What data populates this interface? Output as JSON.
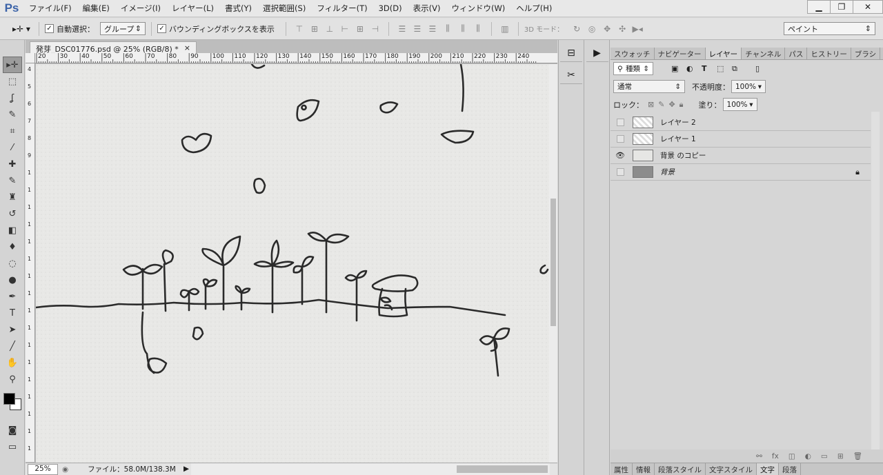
{
  "app": {
    "logo": "Ps"
  },
  "menu": [
    "ファイル(F)",
    "編集(E)",
    "イメージ(I)",
    "レイヤー(L)",
    "書式(Y)",
    "選択範囲(S)",
    "フィルター(T)",
    "3D(D)",
    "表示(V)",
    "ウィンドウ(W)",
    "ヘルプ(H)"
  ],
  "window_controls": {
    "minimize": "▁",
    "restore": "❐",
    "close": "✕"
  },
  "options": {
    "auto_select_label": "自動選択：",
    "auto_select_value": "グループ",
    "bounding_box_label": "バウンディングボックスを表示",
    "mode3d_label": "3D モード：",
    "workspace": "ペイント"
  },
  "document": {
    "tab_title": "発芽_DSC01776.psd @ 25% (RGB/8) *",
    "tab_close": "×",
    "ruler_h": [
      "20",
      "30",
      "40",
      "50",
      "60",
      "70",
      "80",
      "90",
      "100",
      "110",
      "120",
      "130",
      "140",
      "150",
      "160",
      "170",
      "180",
      "190",
      "200",
      "210",
      "220",
      "230",
      "240"
    ],
    "ruler_v": [
      "4",
      "5",
      "6",
      "7",
      "8",
      "9",
      "1",
      "1",
      "1",
      "1",
      "1",
      "1",
      "1",
      "1",
      "1",
      "1",
      "1",
      "1",
      "1",
      "1",
      "1",
      "1",
      "1"
    ],
    "zoom": "25%",
    "file_info": "ファイル：58.0M/138.3M"
  },
  "panels": {
    "tabs": [
      "スウォッチ",
      "ナビゲーター",
      "レイヤー",
      "チャンネル",
      "パス",
      "ヒストリー",
      "ブラシ"
    ],
    "active_tab": "レイヤー",
    "filter_kind": "種類",
    "blend_mode": "通常",
    "opacity_label": "不透明度：",
    "opacity_value": "100%",
    "lock_label": "ロック：",
    "fill_label": "塗り：",
    "fill_value": "100%",
    "layers": [
      {
        "name": "レイヤー 2",
        "visible": false,
        "thumb": "transparent"
      },
      {
        "name": "レイヤー 1",
        "visible": false,
        "thumb": "transparent"
      },
      {
        "name": "背景 のコピー",
        "visible": true,
        "thumb": "photo"
      },
      {
        "name": "背景",
        "visible": false,
        "thumb": "dark",
        "locked": true
      }
    ],
    "bottom_tabs": [
      "属性",
      "情報",
      "段落スタイル",
      "文字スタイル",
      "文字",
      "段落"
    ],
    "bottom_active": "文字"
  }
}
